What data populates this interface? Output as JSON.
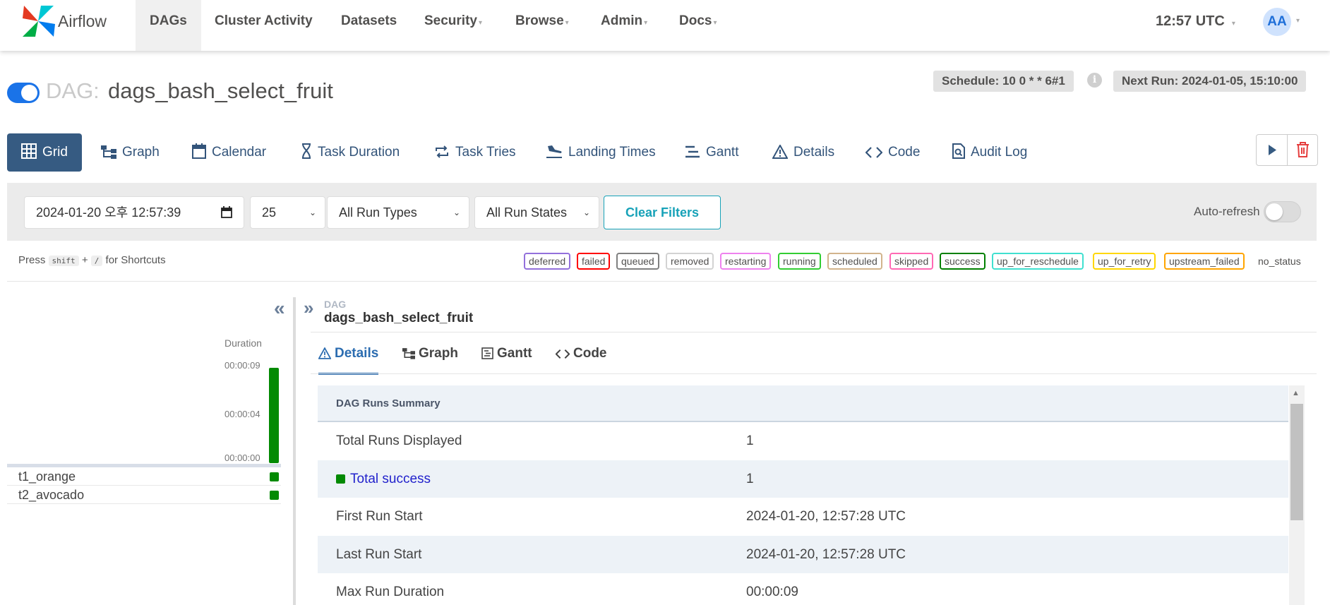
{
  "navbar": {
    "brand": "Airflow",
    "items": [
      {
        "label": "DAGs",
        "active": true
      },
      {
        "label": "Cluster Activity"
      },
      {
        "label": "Datasets"
      },
      {
        "label": "Security",
        "dropdown": true
      },
      {
        "label": "Browse",
        "dropdown": true
      },
      {
        "label": "Admin",
        "dropdown": true
      },
      {
        "label": "Docs",
        "dropdown": true
      }
    ],
    "time": "12:57 UTC",
    "avatar": "AA"
  },
  "dag": {
    "prefix": "DAG:",
    "id": "dags_bash_select_fruit",
    "paused": false,
    "schedule": "Schedule: 10 0 * * 6#1",
    "next_run": "Next Run: 2024-01-05, 15:10:00",
    "info_glyph": "i"
  },
  "view_tabs": [
    {
      "label": "Grid",
      "icon": "grid-icon",
      "active": true
    },
    {
      "label": "Graph",
      "icon": "graph-icon"
    },
    {
      "label": "Calendar",
      "icon": "calendar-icon"
    },
    {
      "label": "Task Duration",
      "icon": "hourglass-icon"
    },
    {
      "label": "Task Tries",
      "icon": "repeat-icon"
    },
    {
      "label": "Landing Times",
      "icon": "plane-landing-icon"
    },
    {
      "label": "Gantt",
      "icon": "gantt-icon"
    },
    {
      "label": "Details",
      "icon": "warning-triangle-icon"
    },
    {
      "label": "Code",
      "icon": "code-icon"
    },
    {
      "label": "Audit Log",
      "icon": "search-document-icon"
    }
  ],
  "actions": {
    "trigger_icon": "play-icon",
    "delete_icon": "trash-icon"
  },
  "filters": {
    "datetime": "2024-01-20 오후 12:57:39",
    "num_runs": "25",
    "run_type": "All Run Types",
    "run_state": "All Run States",
    "clear_label": "Clear Filters",
    "autorefresh_label": "Auto-refresh",
    "autorefresh_on": false
  },
  "shortcut": {
    "press": "Press",
    "key1": "shift",
    "plus": "+",
    "key2": "/",
    "suffix": "for Shortcuts"
  },
  "legend": [
    {
      "label": "deferred",
      "color": "#9370db"
    },
    {
      "label": "failed",
      "color": "#ff0000"
    },
    {
      "label": "queued",
      "color": "#808080"
    },
    {
      "label": "removed",
      "color": "#d3d3d3"
    },
    {
      "label": "restarting",
      "color": "#ee82ee"
    },
    {
      "label": "running",
      "color": "#32cd32"
    },
    {
      "label": "scheduled",
      "color": "#d2b48c"
    },
    {
      "label": "skipped",
      "color": "#ff69b4"
    },
    {
      "label": "success",
      "color": "#008000"
    },
    {
      "label": "up_for_reschedule",
      "color": "#40e0d0"
    },
    {
      "label": "up_for_retry",
      "color": "#ffd700"
    },
    {
      "label": "upstream_failed",
      "color": "#ffa500"
    },
    {
      "label": "no_status",
      "color": "transparent"
    }
  ],
  "grid": {
    "duration_label": "Duration",
    "ticks": [
      "00:00:09",
      "00:00:04",
      "00:00:00"
    ],
    "run_duration_fraction": 1.0,
    "tasks": [
      {
        "name": "t1_orange",
        "state": "success"
      },
      {
        "name": "t2_avocado",
        "state": "success"
      }
    ]
  },
  "detail": {
    "crumb_label": "DAG",
    "crumb_title": "dags_bash_select_fruit",
    "tabs": [
      {
        "label": "Details",
        "icon": "warning-triangle-icon",
        "active": true
      },
      {
        "label": "Graph",
        "icon": "graph-icon"
      },
      {
        "label": "Gantt",
        "icon": "gantt-icon"
      },
      {
        "label": "Code",
        "icon": "code-icon"
      }
    ],
    "summary_title": "DAG Runs Summary",
    "rows": [
      {
        "key": "Total Runs Displayed",
        "value": "1"
      },
      {
        "key": "Total success",
        "value": "1"
      },
      {
        "key": "First Run Start",
        "value": "2024-01-20, 12:57:28 UTC"
      },
      {
        "key": "Last Run Start",
        "value": "2024-01-20, 12:57:28 UTC"
      },
      {
        "key": "Max Run Duration",
        "value": "00:00:09"
      }
    ]
  },
  "colors": {
    "accent": "#365b82",
    "success": "#038a03",
    "teal": "#17a2b8",
    "toggle": "#1a73e8"
  }
}
